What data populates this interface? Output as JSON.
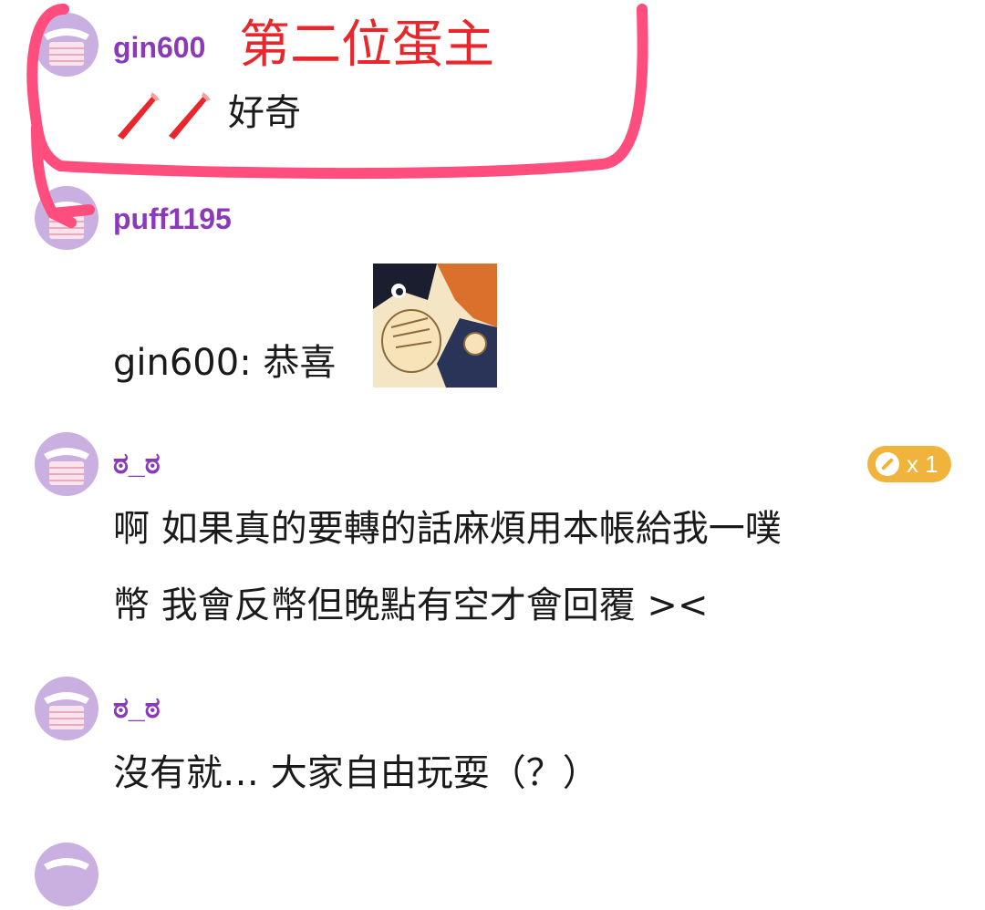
{
  "annotation": {
    "label": "第二位蛋主",
    "color": "#e8262c",
    "circle_color": "#ff4d7e"
  },
  "comments": [
    {
      "username": "gin600",
      "message": "好奇",
      "emoji": "party-horn-icon x2"
    },
    {
      "username": "puff1195",
      "message": "gin600: 恭喜",
      "sticker": "anime-whisper-sticker"
    },
    {
      "username": "ಠ_ಠ",
      "lines": [
        "啊 如果真的要轉的話麻煩用本帳給我一噗",
        "幣 我會反幣但晚點有空才會回覆 ><"
      ],
      "badge": {
        "icon": "coin-icon",
        "count": "x 1"
      }
    },
    {
      "username": "ಠ_ಠ",
      "message": "沒有就… 大家自由玩耍（？）"
    }
  ],
  "colors": {
    "username": "#8a3ab8",
    "avatar_bg": "#c9b0e0",
    "badge": "#f0b43c"
  }
}
